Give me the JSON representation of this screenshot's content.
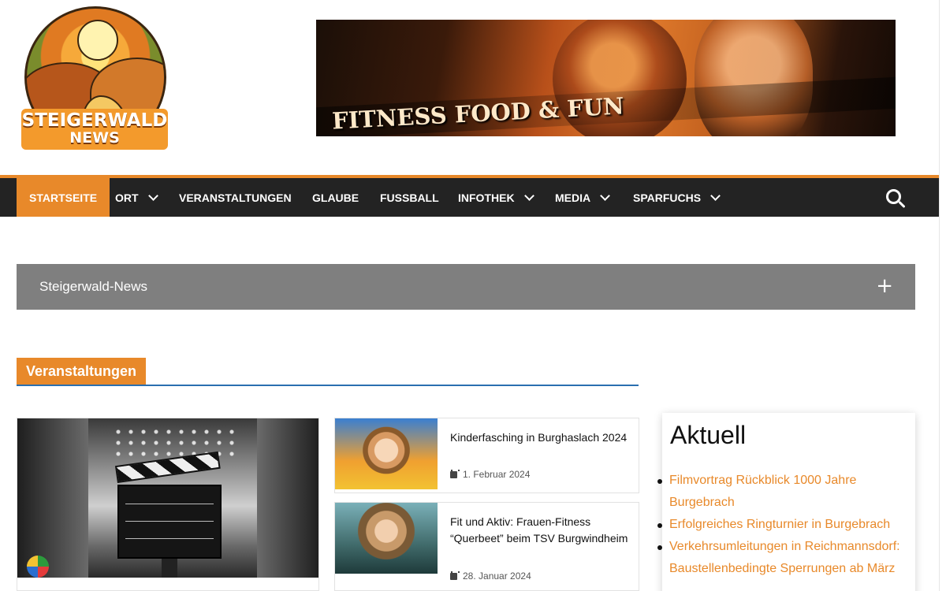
{
  "header": {
    "logo_line1": "STEIGERWALD",
    "logo_line2": "NEWS",
    "ad_text": "FITNESS FOOD & FUN"
  },
  "nav": {
    "items": [
      {
        "label": "STARTSEITE",
        "active": true,
        "dropdown": false
      },
      {
        "label": "ORT",
        "active": false,
        "dropdown": true
      },
      {
        "label": "VERANSTALTUNGEN",
        "active": false,
        "dropdown": false
      },
      {
        "label": "GLAUBE",
        "active": false,
        "dropdown": false
      },
      {
        "label": "FUSSBALL",
        "active": false,
        "dropdown": false
      },
      {
        "label": "INFOTHEK",
        "active": false,
        "dropdown": true
      },
      {
        "label": "MEDIA",
        "active": false,
        "dropdown": true
      },
      {
        "label": "SPARFUCHS",
        "active": false,
        "dropdown": true
      }
    ],
    "search_icon": "search-icon"
  },
  "accordion": {
    "title": "Steigerwald-News",
    "toggle_icon": "plus-icon"
  },
  "section": {
    "title": "Veranstaltungen"
  },
  "cards": [
    {
      "title": "Kinderfasching in Burghaslach 2024",
      "date": "1. Februar 2024"
    },
    {
      "title": "Fit und Aktiv: Frauen-Fitness “Querbeet” beim TSV Burgwindheim",
      "date": "28. Januar 2024"
    }
  ],
  "sidebar": {
    "title": "Aktuell",
    "links": [
      "Filmvortrag Rückblick 1000 Jahre Burgebrach",
      "Erfolgreiches Ringturnier in Burgebrach",
      "Verkehrsumleitungen in Reichmannsdorf: Baustellenbedingte Sperrungen ab März"
    ]
  },
  "colors": {
    "accent": "#e8892a",
    "nav_bg": "#232323",
    "accordion_bg": "#7f7f7f",
    "section_underline": "#2a6fb0"
  }
}
